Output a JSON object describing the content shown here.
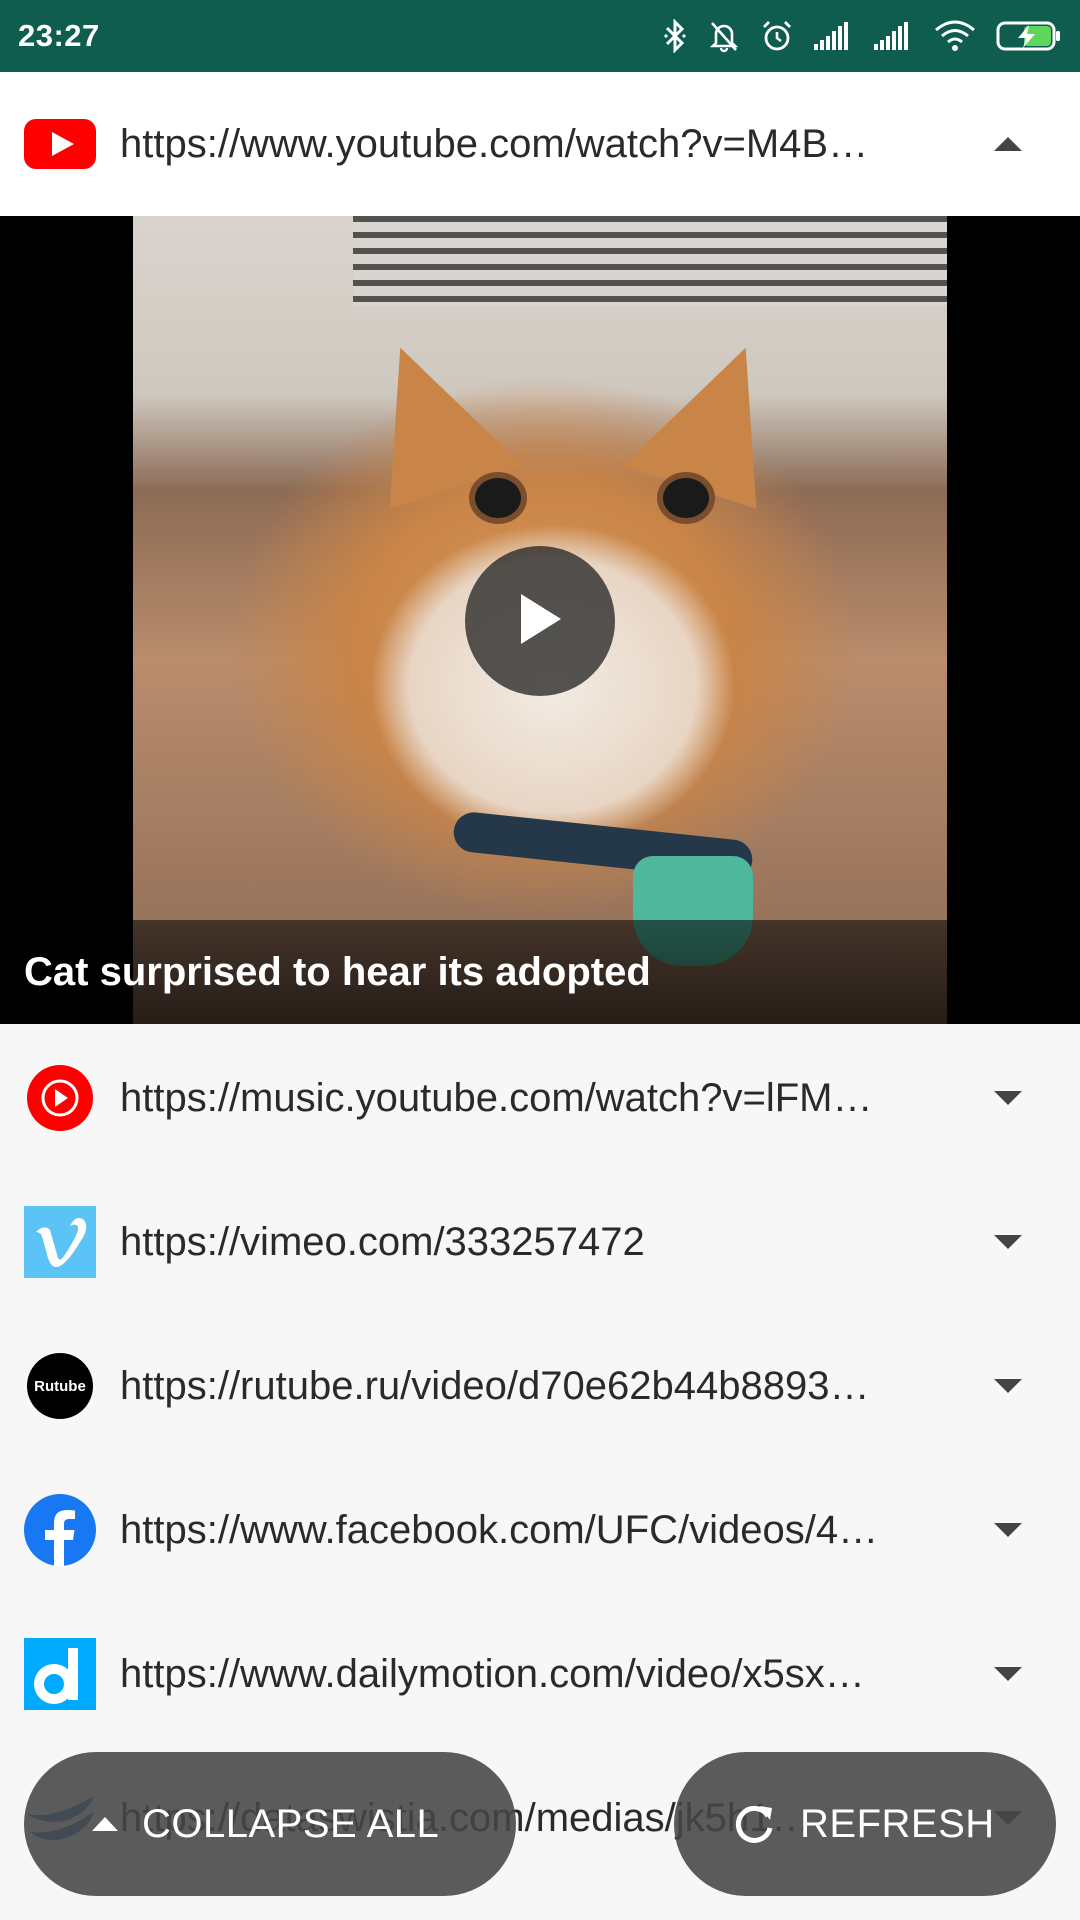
{
  "status_bar": {
    "time": "23:27",
    "icons": [
      "bluetooth-icon",
      "bell-off-icon",
      "alarm-icon",
      "signal-icon",
      "signal-icon",
      "wifi-icon",
      "battery-charging-icon"
    ]
  },
  "items": [
    {
      "service": "YouTube",
      "logo": "youtube-logo",
      "url": "https://www.youtube.com/watch?v=M4B…",
      "expanded": true,
      "chevron": "chevron-up-icon"
    },
    {
      "service": "YouTube Music",
      "logo": "youtube-music-logo",
      "url": "https://music.youtube.com/watch?v=lFM…",
      "expanded": false,
      "chevron": "chevron-down-icon"
    },
    {
      "service": "Vimeo",
      "logo": "vimeo-logo",
      "url": "https://vimeo.com/333257472",
      "expanded": false,
      "chevron": "chevron-down-icon"
    },
    {
      "service": "Rutube",
      "logo": "rutube-logo",
      "logo_text": "Rutube",
      "url": "https://rutube.ru/video/d70e62b44b8893…",
      "expanded": false,
      "chevron": "chevron-down-icon"
    },
    {
      "service": "Facebook",
      "logo": "facebook-logo",
      "url": "https://www.facebook.com/UFC/videos/4…",
      "expanded": false,
      "chevron": "chevron-down-icon"
    },
    {
      "service": "Dailymotion",
      "logo": "dailymotion-logo",
      "url": "https://www.dailymotion.com/video/x5sx…",
      "expanded": false,
      "chevron": "chevron-down-icon"
    },
    {
      "service": "Wistia",
      "logo": "wistia-logo",
      "url": "https://dataswistia.com/medias/jk5h1…",
      "expanded": false,
      "chevron": "chevron-down-icon"
    }
  ],
  "player": {
    "title": "Cat surprised to hear its adopted",
    "play_icon": "play-icon"
  },
  "buttons": {
    "collapse_all": "COLLAPSE ALL",
    "refresh": "REFRESH"
  },
  "colors": {
    "status_bar": "#0e5d4f",
    "youtube_red": "#ff0000",
    "vimeo_blue": "#5bc3f5",
    "facebook_blue": "#1877f2",
    "dailymotion_blue": "#00aaff",
    "fab_background": "#464646"
  }
}
